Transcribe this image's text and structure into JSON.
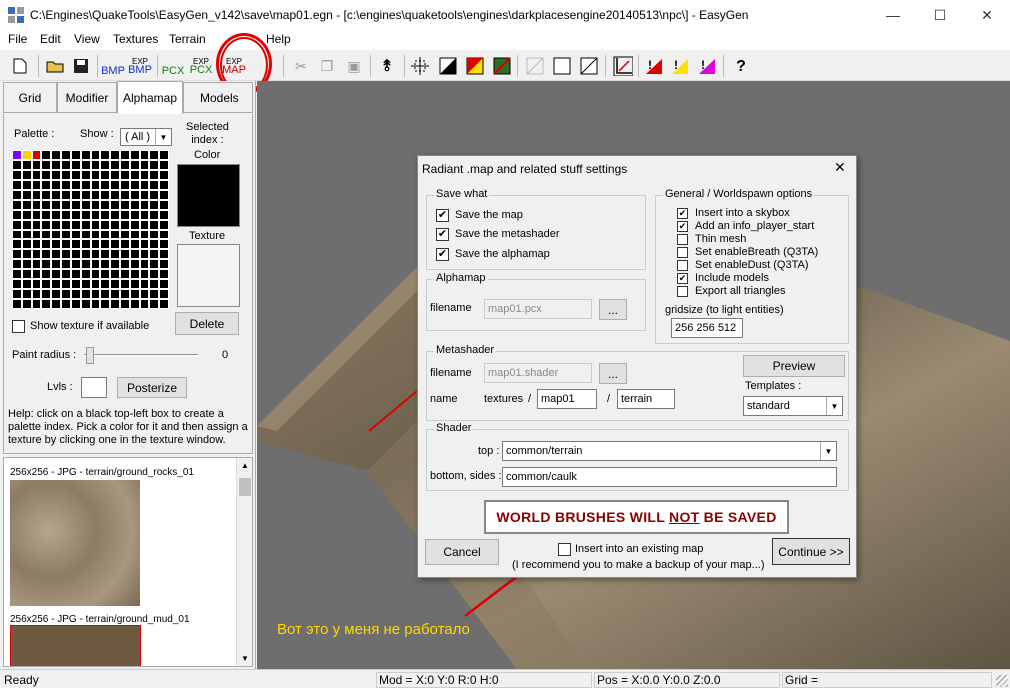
{
  "window": {
    "title": "C:\\Engines\\QuakeTools\\EasyGen_v142\\save\\map01.egn - [c:\\engines\\quaketools\\engines\\darkplacesengine20140513\\npc\\] - EasyGen",
    "minimize": "—",
    "maximize": "☐",
    "close": "✕"
  },
  "menu": [
    "File",
    "Edit",
    "View",
    "Textures",
    "Terrain",
    "Help"
  ],
  "toolbar": {
    "exp_bmp_top": "BMP",
    "exp_bmp_top_label": "EXP",
    "exp_pcx_top": "PCX",
    "exp_label": "EXP",
    "map_label": "MAP",
    "help": "?"
  },
  "left": {
    "tabs": [
      "Grid",
      "Modifier",
      "Alphamap",
      "Models"
    ],
    "palette_label": "Palette :",
    "show_label": "Show :",
    "show_value": "( All )",
    "selected_index": "Selected\nindex :",
    "color_label": "Color",
    "texture_label": "Texture",
    "show_texture": "Show texture if available",
    "delete_btn": "Delete",
    "paint_radius": "Paint radius :",
    "paint_radius_value": "0",
    "lvls": "Lvls :",
    "posterize_btn": "Posterize",
    "help": "Help: click on a black top-left box to create a palette index. Pick a color for it and then assign a texture by clicking one in the texture window.",
    "textures": [
      "256x256 - JPG - terrain/ground_rocks_01",
      "256x256 - JPG - terrain/ground_mud_01"
    ]
  },
  "dialog": {
    "title": "Radiant .map and related stuff settings",
    "close": "✕",
    "save_what": "Save what",
    "save_items": [
      "Save the map",
      "Save the metashader",
      "Save the alphamap"
    ],
    "general": "General / Worldspawn options",
    "general_items": [
      {
        "label": "Insert into a skybox",
        "checked": true
      },
      {
        "label": "Add an info_player_start",
        "checked": true
      },
      {
        "label": "Thin mesh",
        "checked": false
      },
      {
        "label": "Set enableBreath (Q3TA)",
        "checked": false
      },
      {
        "label": "Set enableDust (Q3TA)",
        "checked": false
      },
      {
        "label": "Include models",
        "checked": true
      },
      {
        "label": "Export all triangles",
        "checked": false
      }
    ],
    "gridsize_label": "gridsize (to light entities)",
    "gridsize_value": "256 256 512",
    "alphamap": "Alphamap",
    "filename_label": "filename",
    "alphamap_file": "map01.pcx",
    "browse": "...",
    "metashader": "Metashader",
    "metashader_file": "map01.shader",
    "name_label": "name",
    "textures_label": "textures",
    "slash": "/",
    "name_value1": "map01",
    "name_value2": "terrain",
    "preview_btn": "Preview",
    "templates_label": "Templates :",
    "templates_value": "standard",
    "shader": "Shader",
    "top_label": "top :",
    "top_value": "common/terrain",
    "bottom_label": "bottom, sides :",
    "bottom_value": "common/caulk",
    "warning_pre": "WORLD BRUSHES WILL ",
    "warning_not": "NOT",
    "warning_post": " BE SAVED",
    "cancel_btn": "Cancel",
    "insert_existing": "Insert into an existing map",
    "recommend": "(I recommend you to make a backup of your map...)",
    "continue_btn": "Continue >>"
  },
  "annotation": "Вот это у меня не работало",
  "status": {
    "ready": "Ready",
    "mod": "Mod = X:0 Y:0 R:0 H:0",
    "pos": "Pos = X:0.0 Y:0.0 Z:0.0",
    "grid": "Grid ="
  },
  "colors": {
    "accent_red": "#e00000",
    "annotation_yellow": "#ffd800",
    "warning_text": "#8b0000"
  }
}
